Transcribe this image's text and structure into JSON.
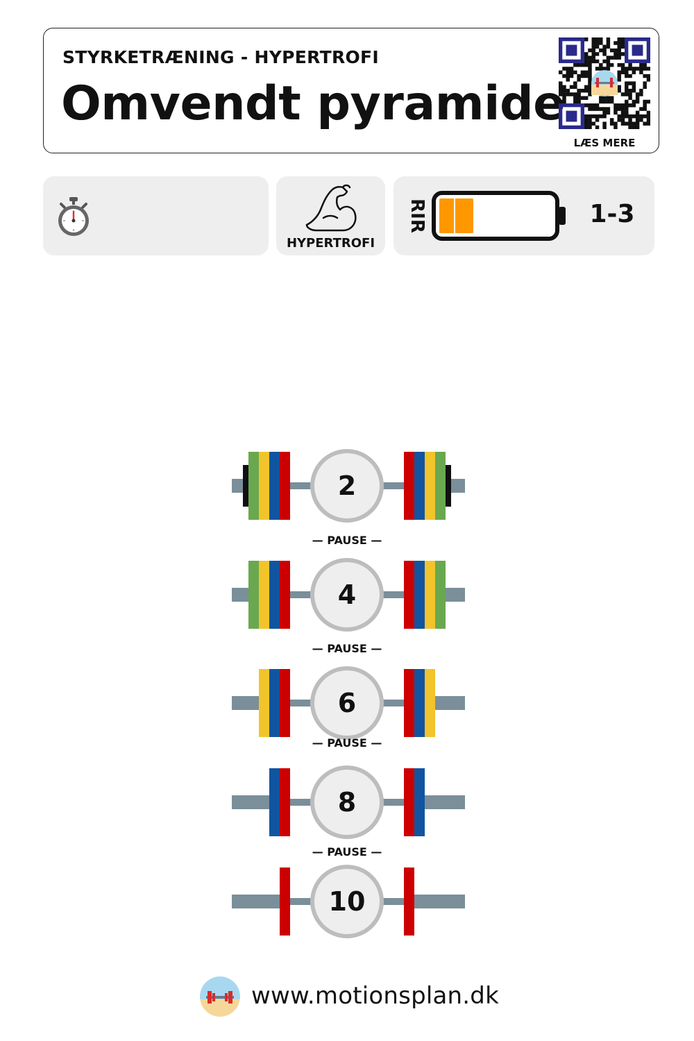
{
  "header": {
    "subtitle": "STYRKETRÆNING - HYPERTROFI",
    "title": "Omvendt pyramide",
    "qr_label": "LÆS MERE"
  },
  "info": {
    "timer_icon": "stopwatch-icon",
    "goal_icon": "flexed-biceps-icon",
    "goal_label": "HYPERTROFI",
    "rir_label": "RIR",
    "rir_value": "1-3",
    "battery_level": 0.3,
    "battery_color": "#ff9800"
  },
  "sets": [
    {
      "reps": "2",
      "plates": [
        "#cc0000",
        "#1155a0",
        "#f2c42c",
        "#6aa84f"
      ],
      "collar": true
    },
    {
      "reps": "4",
      "plates": [
        "#cc0000",
        "#1155a0",
        "#f2c42c",
        "#6aa84f"
      ],
      "collar": false
    },
    {
      "reps": "6",
      "plates": [
        "#cc0000",
        "#1155a0",
        "#f2c42c"
      ],
      "collar": false
    },
    {
      "reps": "8",
      "plates": [
        "#cc0000",
        "#1155a0"
      ],
      "collar": false
    },
    {
      "reps": "10",
      "plates": [
        "#cc0000"
      ],
      "collar": false
    }
  ],
  "pause_label": "— PAUSE —",
  "footer": {
    "url": "www.motionsplan.dk"
  },
  "colors": {
    "bar": "#7a8f9a",
    "circle_fill": "#eeeeee",
    "circle_stroke": "#bdbdbd",
    "card_bg": "#eeeeee"
  }
}
